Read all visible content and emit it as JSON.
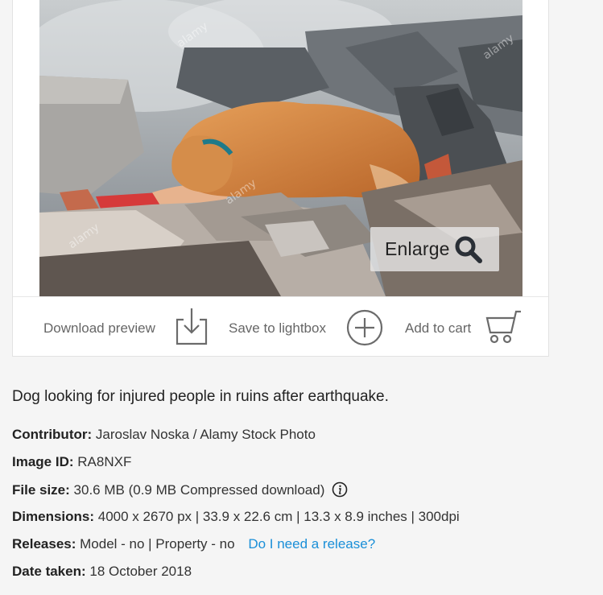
{
  "photo": {
    "alt": "Dog looking for injured people in ruins after earthquake.",
    "watermark": "alamy",
    "enlarge_label": "Enlarge",
    "enlarge_icon": "search-icon"
  },
  "actions": {
    "download_label": "Download preview",
    "download_icon": "download-icon",
    "lightbox_label": "Save to lightbox",
    "lightbox_icon": "plus-circle-icon",
    "cart_label": "Add to cart",
    "cart_icon": "cart-icon"
  },
  "description": "Dog looking for injured people in ruins after earthquake.",
  "meta": {
    "contributor_label": "Contributor:",
    "contributor_value": "Jaroslav Noska / Alamy Stock Photo",
    "image_id_label": "Image ID:",
    "image_id_value": "RA8NXF",
    "file_size_label": "File size:",
    "file_size_value": "30.6 MB (0.9 MB Compressed download)",
    "dimensions_label": "Dimensions:",
    "dimensions_value": "4000 x 2670 px | 33.9 x 22.6 cm | 13.3 x 8.9 inches | 300dpi",
    "releases_label": "Releases:",
    "releases_value": "Model - no | Property - no",
    "releases_link": "Do I need a release?",
    "date_label": "Date taken:",
    "date_value": "18 October 2018"
  },
  "colors": {
    "link": "#1a8fd8",
    "icon_gray": "#6b6b6b",
    "background": "#f5f5f5"
  }
}
